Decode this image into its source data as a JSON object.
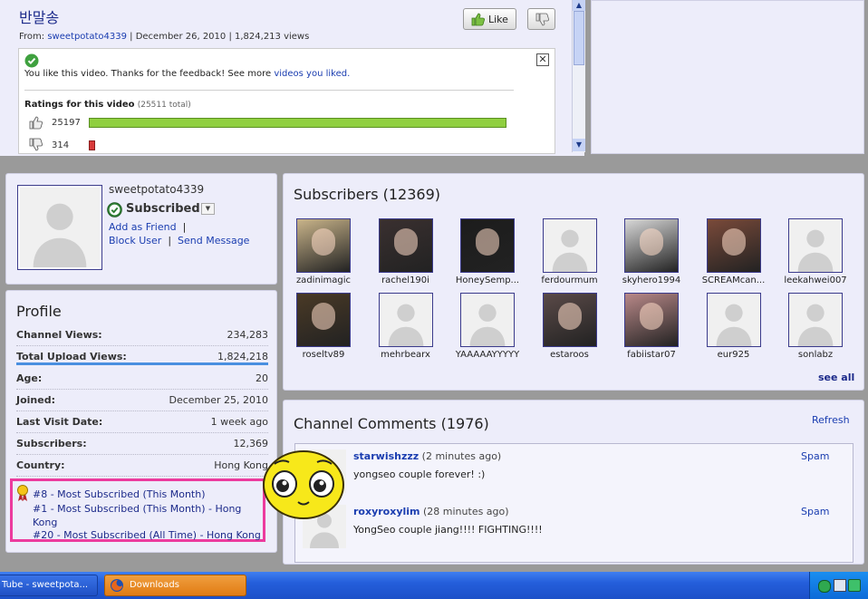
{
  "video": {
    "title": "반말송",
    "from_label": "From:",
    "uploader": "sweetpotato4339",
    "date": "December 26, 2010",
    "views": "1,824,213 views",
    "like_label": "Like",
    "feedback_text": "You like this video. Thanks for the feedback! See more",
    "feedback_link": "videos you liked.",
    "ratings_title": "Ratings for this video",
    "ratings_total": "(25511 total)",
    "likes_count": "25197",
    "dislikes_count": "314",
    "like_fraction": 0.988,
    "dislike_fraction": 0.012
  },
  "channel": {
    "username": "sweetpotato4339",
    "subscribed_label": "Subscribed",
    "add_friend": "Add as Friend",
    "block_user": "Block User",
    "send_message": "Send Message"
  },
  "profile": {
    "heading": "Profile",
    "rows": [
      {
        "key": "Channel Views:",
        "value": "234,283"
      },
      {
        "key": "Total Upload Views:",
        "value": "1,824,218"
      },
      {
        "key": "Age:",
        "value": "20"
      },
      {
        "key": "Joined:",
        "value": "December 25, 2010"
      },
      {
        "key": "Last Visit Date:",
        "value": "1 week ago"
      },
      {
        "key": "Subscribers:",
        "value": "12,369"
      },
      {
        "key": "Country:",
        "value": "Hong Kong"
      }
    ],
    "honors": [
      "#8 - Most Subscribed (This Month)",
      "#1 - Most Subscribed (This Month) - Hong Kong",
      "#20 - Most Subscribed (All Time) - Hong Kong"
    ]
  },
  "subscribers": {
    "heading": "Subscribers (12369)",
    "see_all": "see all",
    "items": [
      {
        "name": "zadinimagic",
        "photo": true,
        "color": "#c9b48a"
      },
      {
        "name": "rachel190i",
        "photo": true,
        "color": "#3a3030"
      },
      {
        "name": "HoneySemp...",
        "photo": true,
        "color": "#1c1c1c"
      },
      {
        "name": "ferdourmum",
        "photo": false,
        "color": "#f0f0f0"
      },
      {
        "name": "skyhero1994",
        "photo": true,
        "color": "#d8d8d8"
      },
      {
        "name": "SCREAMcan...",
        "photo": true,
        "color": "#7a4a3a"
      },
      {
        "name": "leekahwei007",
        "photo": false,
        "color": "#f0f0f0"
      },
      {
        "name": "roseltv89",
        "photo": true,
        "color": "#4a3a26"
      },
      {
        "name": "mehrbearx",
        "photo": false,
        "color": "#f0f0f0"
      },
      {
        "name": "YAAAAAYYYYY",
        "photo": false,
        "color": "#f0f0f0"
      },
      {
        "name": "estaroos",
        "photo": true,
        "color": "#5a4a48"
      },
      {
        "name": "fabiistar07",
        "photo": true,
        "color": "#b88888"
      },
      {
        "name": "eur925",
        "photo": false,
        "color": "#f0f0f0"
      },
      {
        "name": "sonlabz",
        "photo": false,
        "color": "#f0f0f0"
      }
    ]
  },
  "comments": {
    "heading": "Channel Comments (1976)",
    "refresh": "Refresh",
    "items": [
      {
        "user": "starwishzzz",
        "time": "(2 minutes ago)",
        "text": "yongseo couple forever! :)",
        "spam": "Spam"
      },
      {
        "user": "roxyroxylim",
        "time": "(28 minutes ago)",
        "text": "YongSeo couple jiang!!!! FIGHTING!!!!",
        "spam": "Spam"
      }
    ]
  },
  "taskbar": {
    "task1": "Tube - sweetpota...",
    "task2": "Downloads"
  }
}
